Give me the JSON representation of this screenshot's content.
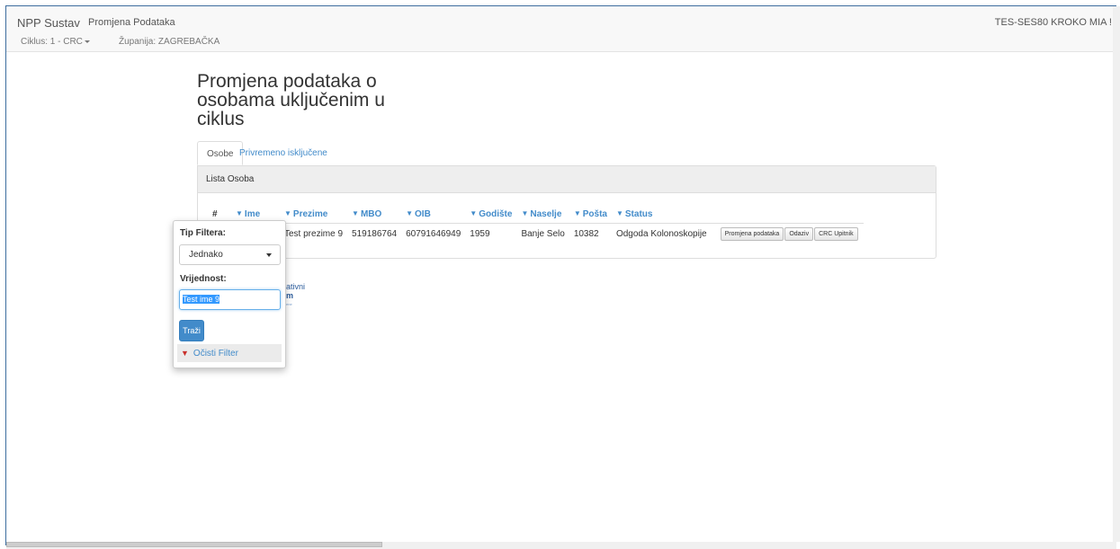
{
  "navbar": {
    "brand": "NPP Sustav",
    "breadcrumb": "Promjena Podataka",
    "user": "TES-SES80 KROKO MIA !",
    "ciklus": "Ciklus: 1 - CRC",
    "zupanija": "Županija: ZAGREBAČKA"
  },
  "page": {
    "title": "Promjena podataka o osobama uključenim u ciklus"
  },
  "tabs": [
    {
      "label": "Osobe",
      "active": true
    },
    {
      "label": "Privremeno isključene",
      "active": false
    }
  ],
  "panel": {
    "heading": "Lista Osoba",
    "columns": [
      "#",
      "Ime",
      "Prezime",
      "MBO",
      "OIB",
      "Godište",
      "Naselje",
      "Pošta",
      "Status"
    ],
    "rows": [
      {
        "prezime": "Test prezime 9",
        "mbo": "519186764",
        "oib": "60791646949",
        "godiste": "1959",
        "naselje": "Banje Selo",
        "posta": "10382",
        "status": "Odgoda Kolonoskopije"
      }
    ],
    "actions": [
      "Promjena podataka",
      "Odaziv",
      "CRC Upitnik"
    ]
  },
  "filter_popup": {
    "type_label": "Tip Filtera:",
    "type_value": "Jednako",
    "value_label": "Vrijednost:",
    "value": "Test ime 9",
    "search_label": "Traži",
    "clear_label": "Očisti Filter"
  },
  "logo_fragment": {
    "line1": "ativni",
    "line2": "m",
    "line3": "ene"
  },
  "icons": {
    "filter": "filter-icon",
    "caret": "caret-down-icon"
  },
  "colors": {
    "link": "#428bca",
    "primary_button": "#428bca",
    "panel_header": "#eeeeee"
  }
}
